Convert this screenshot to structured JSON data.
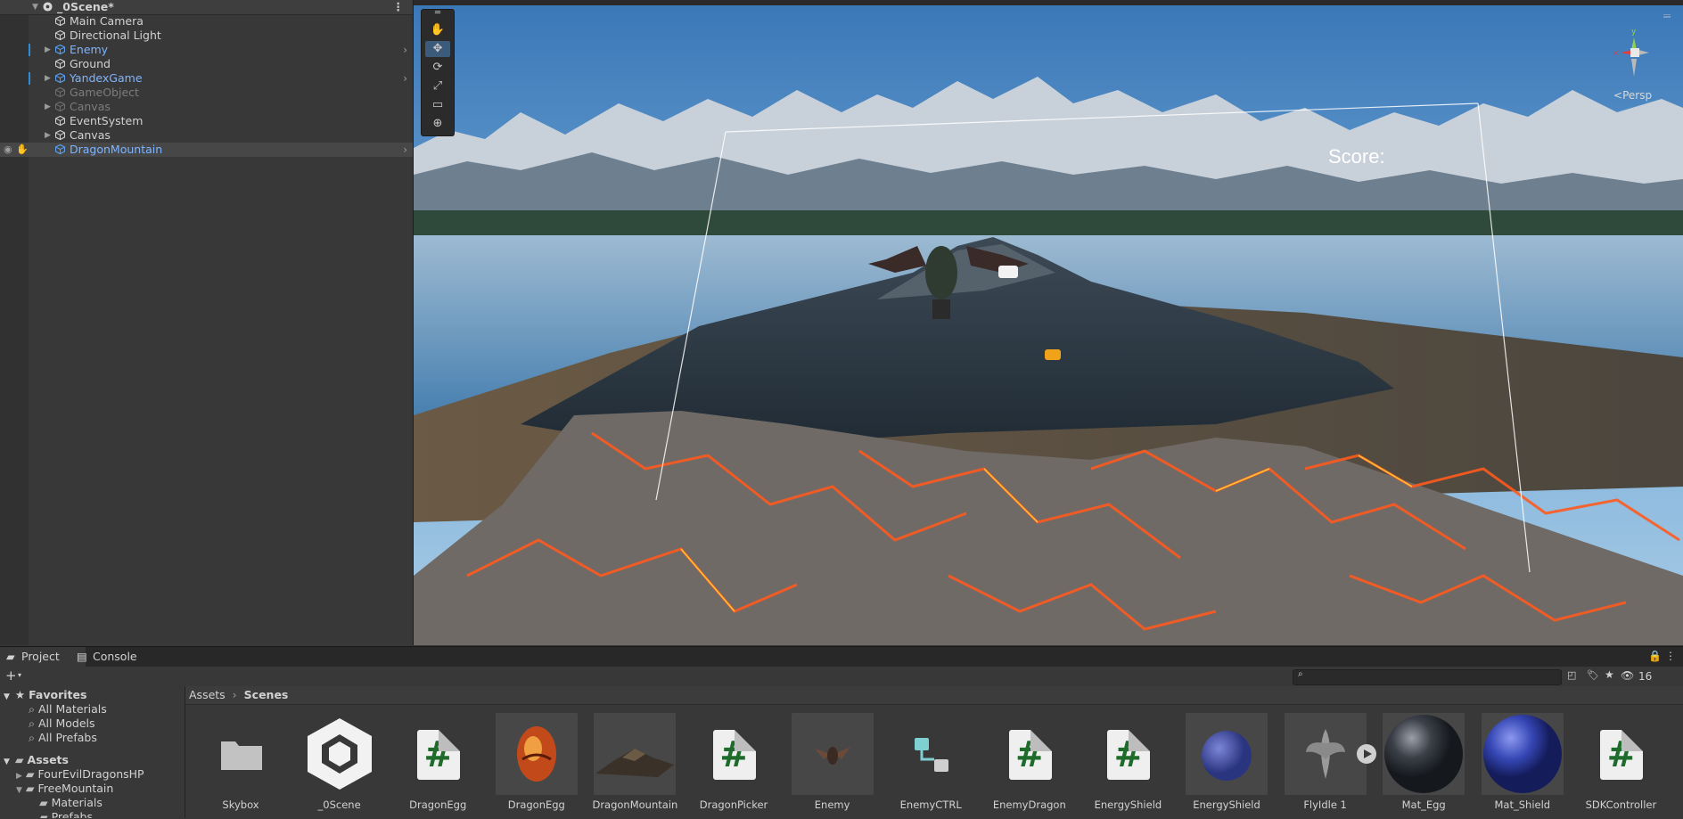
{
  "hierarchy": {
    "scene_name": "_0Scene*",
    "items": [
      {
        "label": "Main Camera",
        "kind": "object"
      },
      {
        "label": "Directional Light",
        "kind": "object"
      },
      {
        "label": "Enemy",
        "kind": "prefab"
      },
      {
        "label": "Ground",
        "kind": "object"
      },
      {
        "label": "YandexGame",
        "kind": "prefab"
      },
      {
        "label": "GameObject",
        "kind": "inactive"
      },
      {
        "label": "Canvas",
        "kind": "inactive"
      },
      {
        "label": "EventSystem",
        "kind": "object"
      },
      {
        "label": "Canvas",
        "kind": "object"
      },
      {
        "label": "DragonMountain",
        "kind": "prefab"
      }
    ]
  },
  "scene": {
    "score_label": "Score:",
    "persp_label": "Persp",
    "gizmo_axes": {
      "y": "y",
      "x": "x",
      "z": "z"
    }
  },
  "bottom": {
    "tabs": [
      {
        "label": "Project"
      },
      {
        "label": "Console"
      }
    ],
    "visibility_count": "16",
    "favorites": {
      "title": "Favorites",
      "items": [
        "All Materials",
        "All Models",
        "All Prefabs"
      ]
    },
    "assets_tree": {
      "title": "Assets",
      "items": [
        "FourEvilDragonsHP",
        "FreeMountain",
        "Materials",
        "Prefabs"
      ]
    },
    "breadcrumb": {
      "root": "Assets",
      "current": "Scenes"
    },
    "assets": [
      {
        "label": "Skybox",
        "type": "folder"
      },
      {
        "label": "_0Scene",
        "type": "unity"
      },
      {
        "label": "DragonEgg",
        "type": "script"
      },
      {
        "label": "DragonEgg",
        "type": "egg"
      },
      {
        "label": "DragonMountain",
        "type": "terrain"
      },
      {
        "label": "DragonPicker",
        "type": "script"
      },
      {
        "label": "Enemy",
        "type": "dragon"
      },
      {
        "label": "EnemyCTRL",
        "type": "animator"
      },
      {
        "label": "EnemyDragon",
        "type": "script"
      },
      {
        "label": "EnergyShield",
        "type": "script"
      },
      {
        "label": "EnergyShield",
        "type": "sphere-small"
      },
      {
        "label": "FlyIdle 1",
        "type": "anim"
      },
      {
        "label": "Mat_Egg",
        "type": "sphere-dark"
      },
      {
        "label": "Mat_Shield",
        "type": "sphere-blue"
      },
      {
        "label": "SDKController",
        "type": "script"
      }
    ]
  },
  "colors": {
    "prefab": "#7fb5ff",
    "selection": "#2d8ed8",
    "panel": "#383838"
  }
}
